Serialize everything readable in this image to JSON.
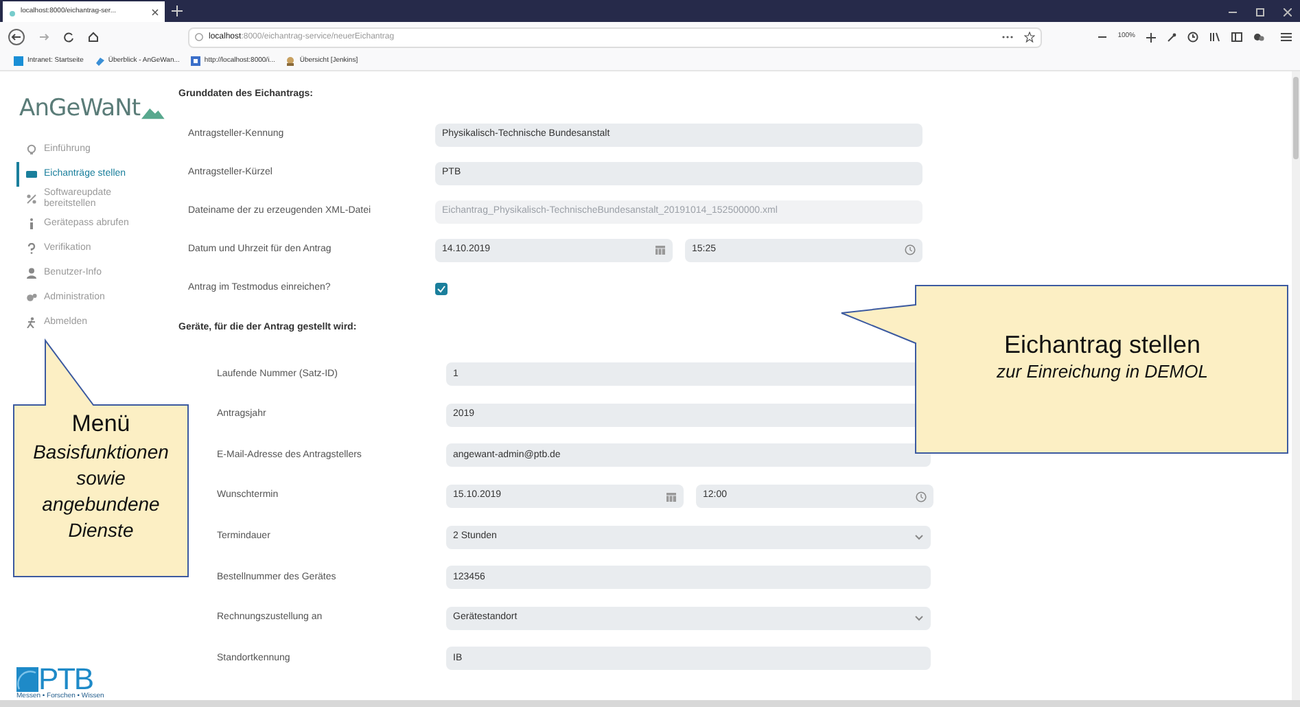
{
  "browser": {
    "tab_title": "localhost:8000/eichantrag-ser...",
    "url_host": "localhost",
    "url_rest": ":8000/eichantrag-service/neuerEichantrag",
    "zoom": "100%",
    "bookmarks": [
      "Intranet: Startseite",
      "Überblick - AnGeWan...",
      "http://localhost:8000/i...",
      "Übersicht [Jenkins]"
    ]
  },
  "sidebar": {
    "logo": "AnGeWaNt",
    "items": [
      {
        "label": "Einführung",
        "selected": false
      },
      {
        "label": "Eichanträge stellen",
        "selected": true
      },
      {
        "label": "Softwareupdate bereitstellen",
        "selected": false
      },
      {
        "label": "Gerätepass abrufen",
        "selected": false
      },
      {
        "label": "Verifikation",
        "selected": false
      },
      {
        "label": "Benutzer-Info",
        "selected": false
      },
      {
        "label": "Administration",
        "selected": false
      },
      {
        "label": "Abmelden",
        "selected": false
      }
    ],
    "footer_logo": "PTB",
    "footer_tagline": "Messen • Forschen • Wissen"
  },
  "sections": [
    {
      "title": "Grunddaten des Eichantrags:",
      "rows": [
        {
          "kind": "text",
          "label": "Antragsteller-Kennung",
          "value": "Physikalisch-Technische Bundesanstalt"
        },
        {
          "kind": "text",
          "label": "Antragsteller-Kürzel",
          "value": "PTB"
        },
        {
          "kind": "disabled",
          "label": "Dateiname der zu erzeugenden XML-Datei",
          "value": "Eichantrag_Physikalisch-TechnischeBundesanstalt_20191014_152500000.xml"
        },
        {
          "kind": "datetime",
          "label": "Datum und Uhrzeit für den Antrag",
          "date": "14.10.2019",
          "time": "15:25"
        },
        {
          "kind": "checkbox",
          "label": "Antrag im Testmodus einreichen?",
          "checked": true
        }
      ]
    },
    {
      "title": "Geräte, für die der Antrag gestellt wird:",
      "rows": [
        {
          "kind": "text",
          "label": "Laufende Nummer (Satz-ID)",
          "value": "1"
        },
        {
          "kind": "text",
          "label": "Antragsjahr",
          "value": "2019"
        },
        {
          "kind": "text",
          "label": "E-Mail-Adresse des Antragstellers",
          "value": "angewant-admin@ptb.de"
        },
        {
          "kind": "datetime",
          "label": "Wunschtermin",
          "date": "15.10.2019",
          "time": "12:00"
        },
        {
          "kind": "select",
          "label": "Termindauer",
          "value": "2 Stunden"
        },
        {
          "kind": "text",
          "label": "Bestellnummer des Gerätes",
          "value": "123456"
        },
        {
          "kind": "select",
          "label": "Rechnungszustellung an",
          "value": "Gerätestandort"
        },
        {
          "kind": "text",
          "label": "Standortkennung",
          "value": "IB"
        }
      ]
    }
  ],
  "callouts": [
    {
      "title": "Menü",
      "lines": [
        "Basisfunktionen",
        "sowie",
        "angebundene",
        "Dienste"
      ]
    },
    {
      "title": "Eichantrag stellen",
      "lines": [
        "zur Einreichung in DEMOL"
      ]
    }
  ]
}
